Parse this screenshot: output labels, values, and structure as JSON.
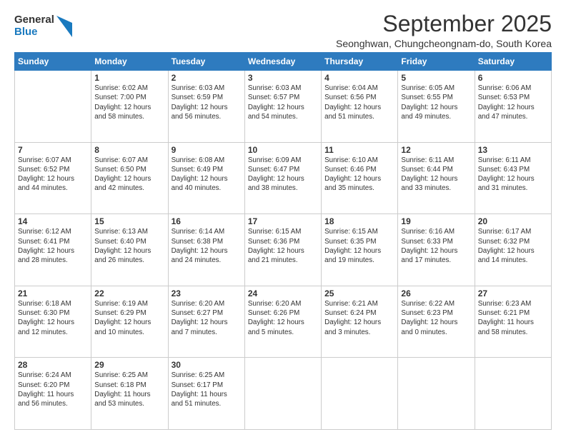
{
  "header": {
    "logo_general": "General",
    "logo_blue": "Blue",
    "month": "September 2025",
    "location": "Seonghwan, Chungcheongnam-do, South Korea"
  },
  "weekdays": [
    "Sunday",
    "Monday",
    "Tuesday",
    "Wednesday",
    "Thursday",
    "Friday",
    "Saturday"
  ],
  "weeks": [
    [
      {
        "day": "",
        "info": ""
      },
      {
        "day": "1",
        "info": "Sunrise: 6:02 AM\nSunset: 7:00 PM\nDaylight: 12 hours\nand 58 minutes."
      },
      {
        "day": "2",
        "info": "Sunrise: 6:03 AM\nSunset: 6:59 PM\nDaylight: 12 hours\nand 56 minutes."
      },
      {
        "day": "3",
        "info": "Sunrise: 6:03 AM\nSunset: 6:57 PM\nDaylight: 12 hours\nand 54 minutes."
      },
      {
        "day": "4",
        "info": "Sunrise: 6:04 AM\nSunset: 6:56 PM\nDaylight: 12 hours\nand 51 minutes."
      },
      {
        "day": "5",
        "info": "Sunrise: 6:05 AM\nSunset: 6:55 PM\nDaylight: 12 hours\nand 49 minutes."
      },
      {
        "day": "6",
        "info": "Sunrise: 6:06 AM\nSunset: 6:53 PM\nDaylight: 12 hours\nand 47 minutes."
      }
    ],
    [
      {
        "day": "7",
        "info": "Sunrise: 6:07 AM\nSunset: 6:52 PM\nDaylight: 12 hours\nand 44 minutes."
      },
      {
        "day": "8",
        "info": "Sunrise: 6:07 AM\nSunset: 6:50 PM\nDaylight: 12 hours\nand 42 minutes."
      },
      {
        "day": "9",
        "info": "Sunrise: 6:08 AM\nSunset: 6:49 PM\nDaylight: 12 hours\nand 40 minutes."
      },
      {
        "day": "10",
        "info": "Sunrise: 6:09 AM\nSunset: 6:47 PM\nDaylight: 12 hours\nand 38 minutes."
      },
      {
        "day": "11",
        "info": "Sunrise: 6:10 AM\nSunset: 6:46 PM\nDaylight: 12 hours\nand 35 minutes."
      },
      {
        "day": "12",
        "info": "Sunrise: 6:11 AM\nSunset: 6:44 PM\nDaylight: 12 hours\nand 33 minutes."
      },
      {
        "day": "13",
        "info": "Sunrise: 6:11 AM\nSunset: 6:43 PM\nDaylight: 12 hours\nand 31 minutes."
      }
    ],
    [
      {
        "day": "14",
        "info": "Sunrise: 6:12 AM\nSunset: 6:41 PM\nDaylight: 12 hours\nand 28 minutes."
      },
      {
        "day": "15",
        "info": "Sunrise: 6:13 AM\nSunset: 6:40 PM\nDaylight: 12 hours\nand 26 minutes."
      },
      {
        "day": "16",
        "info": "Sunrise: 6:14 AM\nSunset: 6:38 PM\nDaylight: 12 hours\nand 24 minutes."
      },
      {
        "day": "17",
        "info": "Sunrise: 6:15 AM\nSunset: 6:36 PM\nDaylight: 12 hours\nand 21 minutes."
      },
      {
        "day": "18",
        "info": "Sunrise: 6:15 AM\nSunset: 6:35 PM\nDaylight: 12 hours\nand 19 minutes."
      },
      {
        "day": "19",
        "info": "Sunrise: 6:16 AM\nSunset: 6:33 PM\nDaylight: 12 hours\nand 17 minutes."
      },
      {
        "day": "20",
        "info": "Sunrise: 6:17 AM\nSunset: 6:32 PM\nDaylight: 12 hours\nand 14 minutes."
      }
    ],
    [
      {
        "day": "21",
        "info": "Sunrise: 6:18 AM\nSunset: 6:30 PM\nDaylight: 12 hours\nand 12 minutes."
      },
      {
        "day": "22",
        "info": "Sunrise: 6:19 AM\nSunset: 6:29 PM\nDaylight: 12 hours\nand 10 minutes."
      },
      {
        "day": "23",
        "info": "Sunrise: 6:20 AM\nSunset: 6:27 PM\nDaylight: 12 hours\nand 7 minutes."
      },
      {
        "day": "24",
        "info": "Sunrise: 6:20 AM\nSunset: 6:26 PM\nDaylight: 12 hours\nand 5 minutes."
      },
      {
        "day": "25",
        "info": "Sunrise: 6:21 AM\nSunset: 6:24 PM\nDaylight: 12 hours\nand 3 minutes."
      },
      {
        "day": "26",
        "info": "Sunrise: 6:22 AM\nSunset: 6:23 PM\nDaylight: 12 hours\nand 0 minutes."
      },
      {
        "day": "27",
        "info": "Sunrise: 6:23 AM\nSunset: 6:21 PM\nDaylight: 11 hours\nand 58 minutes."
      }
    ],
    [
      {
        "day": "28",
        "info": "Sunrise: 6:24 AM\nSunset: 6:20 PM\nDaylight: 11 hours\nand 56 minutes."
      },
      {
        "day": "29",
        "info": "Sunrise: 6:25 AM\nSunset: 6:18 PM\nDaylight: 11 hours\nand 53 minutes."
      },
      {
        "day": "30",
        "info": "Sunrise: 6:25 AM\nSunset: 6:17 PM\nDaylight: 11 hours\nand 51 minutes."
      },
      {
        "day": "",
        "info": ""
      },
      {
        "day": "",
        "info": ""
      },
      {
        "day": "",
        "info": ""
      },
      {
        "day": "",
        "info": ""
      }
    ]
  ]
}
